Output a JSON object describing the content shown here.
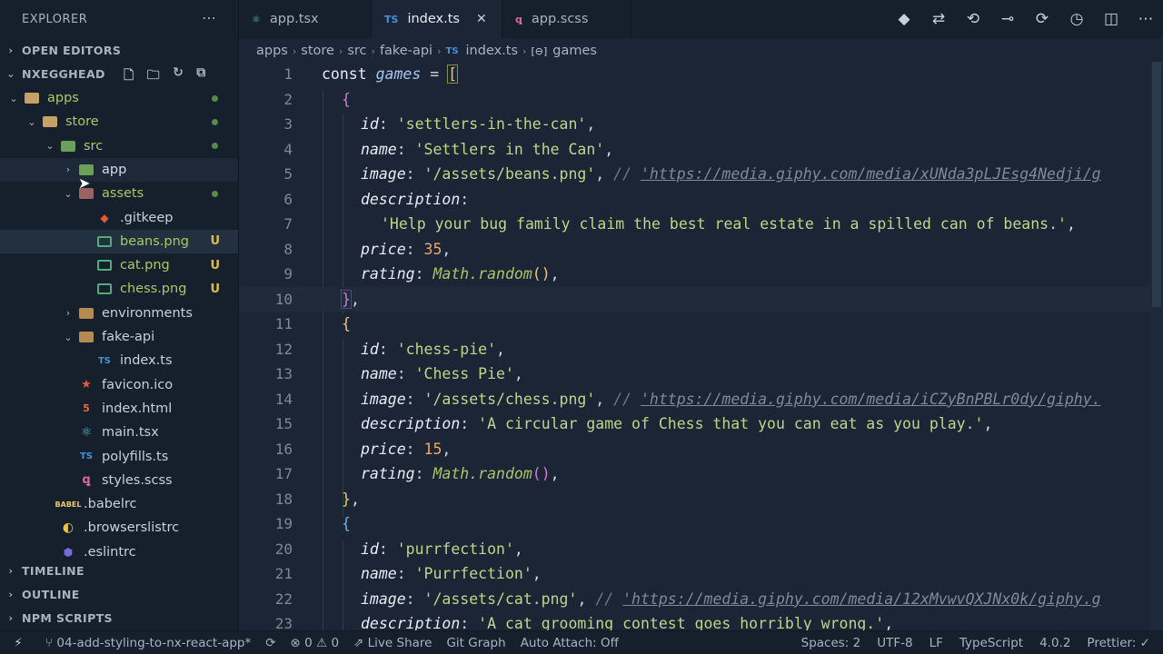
{
  "sidebar": {
    "title": "EXPLORER",
    "sections": {
      "open_editors": "OPEN EDITORS",
      "workspace": "NXEGGHEAD",
      "timeline": "TIMELINE",
      "outline": "OUTLINE",
      "npm_scripts": "NPM SCRIPTS"
    },
    "tree": [
      {
        "label": "apps",
        "depth": 0,
        "arrow": "⌄",
        "status": "dot"
      },
      {
        "label": "store",
        "depth": 1,
        "arrow": "⌄",
        "status": "dot"
      },
      {
        "label": "src",
        "depth": 2,
        "arrow": "⌄",
        "status": "dot"
      },
      {
        "label": "app",
        "depth": 3,
        "arrow": "›",
        "status": ""
      },
      {
        "label": "assets",
        "depth": 3,
        "arrow": "⌄",
        "status": "dot"
      },
      {
        "label": ".gitkeep",
        "depth": 4,
        "arrow": "",
        "status": ""
      },
      {
        "label": "beans.png",
        "depth": 4,
        "arrow": "",
        "status": "U"
      },
      {
        "label": "cat.png",
        "depth": 4,
        "arrow": "",
        "status": "U"
      },
      {
        "label": "chess.png",
        "depth": 4,
        "arrow": "",
        "status": "U"
      },
      {
        "label": "environments",
        "depth": 3,
        "arrow": "›",
        "status": ""
      },
      {
        "label": "fake-api",
        "depth": 3,
        "arrow": "⌄",
        "status": ""
      },
      {
        "label": "index.ts",
        "depth": 4,
        "arrow": "",
        "status": ""
      },
      {
        "label": "favicon.ico",
        "depth": 3,
        "arrow": "",
        "status": ""
      },
      {
        "label": "index.html",
        "depth": 3,
        "arrow": "",
        "status": ""
      },
      {
        "label": "main.tsx",
        "depth": 3,
        "arrow": "",
        "status": ""
      },
      {
        "label": "polyfills.ts",
        "depth": 3,
        "arrow": "",
        "status": ""
      },
      {
        "label": "styles.scss",
        "depth": 3,
        "arrow": "",
        "status": ""
      },
      {
        "label": ".babelrc",
        "depth": 2,
        "arrow": "",
        "status": ""
      },
      {
        "label": ".browserslistrc",
        "depth": 2,
        "arrow": "",
        "status": ""
      },
      {
        "label": ".eslintrc",
        "depth": 2,
        "arrow": "",
        "status": ""
      }
    ]
  },
  "tabs": [
    {
      "label": "app.tsx",
      "icon": "react-icon",
      "active": false
    },
    {
      "label": "index.ts",
      "icon": "typescript-icon",
      "active": true
    },
    {
      "label": "app.scss",
      "icon": "sass-icon",
      "active": false
    }
  ],
  "breadcrumb": [
    "apps",
    "store",
    "src",
    "fake-api",
    "index.ts",
    "games"
  ],
  "code": {
    "lines": [
      {
        "n": "1"
      },
      {
        "n": "2"
      },
      {
        "n": "3"
      },
      {
        "n": "4"
      },
      {
        "n": "5"
      },
      {
        "n": "6"
      },
      {
        "n": "7"
      },
      {
        "n": "8"
      },
      {
        "n": "9"
      },
      {
        "n": "10"
      },
      {
        "n": "11"
      },
      {
        "n": "12"
      },
      {
        "n": "13"
      },
      {
        "n": "14"
      },
      {
        "n": "15"
      },
      {
        "n": "16"
      },
      {
        "n": "17"
      },
      {
        "n": "18"
      },
      {
        "n": "19"
      },
      {
        "n": "20"
      },
      {
        "n": "21"
      },
      {
        "n": "22"
      },
      {
        "n": "23"
      }
    ],
    "kw_const": "const",
    "var_games": "games",
    "games": [
      {
        "id": "'settlers-in-the-can'",
        "name": "'Settlers in the Can'",
        "image": "'/assets/beans.png'",
        "url": "'https://media.giphy.com/media/xUNda3pLJEsg4Nedji/g",
        "description": "'Help your bug family claim the best real estate in a spilled can of beans.'",
        "price": "35"
      },
      {
        "id": "'chess-pie'",
        "name": "'Chess Pie'",
        "image": "'/assets/chess.png'",
        "url": "'https://media.giphy.com/media/iCZyBnPBLr0dy/giphy.",
        "description": "'A circular game of Chess that you can eat as you play.'",
        "price": "15"
      },
      {
        "id": "'purrfection'",
        "name": "'Purrfection'",
        "image": "'/assets/cat.png'",
        "url": "'https://media.giphy.com/media/12xMvwvQXJNx0k/giphy.g",
        "description": "'A cat grooming contest goes horribly wrong.'"
      }
    ],
    "rating_expr": "Math.random"
  },
  "statusbar": {
    "branch": "04-add-styling-to-nx-react-app*",
    "errors": "0",
    "warnings": "0",
    "live_share": "Live Share",
    "git_graph": "Git Graph",
    "auto_attach": "Auto Attach: Off",
    "spaces": "Spaces: 2",
    "encoding": "UTF-8",
    "eol": "LF",
    "language": "TypeScript",
    "version": "4.0.2",
    "prettier": "Prettier: ✓"
  }
}
